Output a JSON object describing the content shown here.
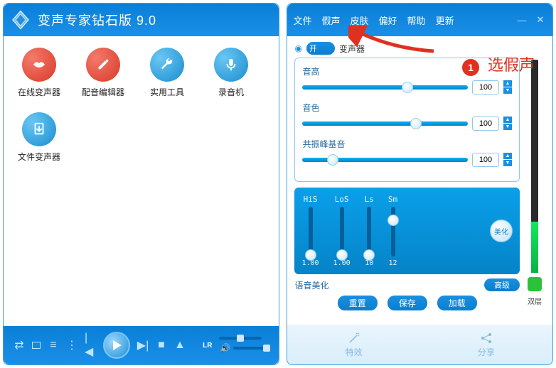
{
  "title": "变声专家钻石版 9.0",
  "tools": [
    {
      "name": "online-voice-changer",
      "label": "在线变声器",
      "color": "red",
      "icon": "lips"
    },
    {
      "name": "dub-editor",
      "label": "配音编辑器",
      "color": "red",
      "icon": "brush"
    },
    {
      "name": "utilities",
      "label": "实用工具",
      "color": "blue",
      "icon": "wrench"
    },
    {
      "name": "recorder",
      "label": "录音机",
      "color": "blue",
      "icon": "mic"
    },
    {
      "name": "file-voice-changer",
      "label": "文件变声器",
      "color": "blue",
      "icon": "doc"
    }
  ],
  "player": {
    "lr": "LR"
  },
  "menu": [
    "文件",
    "假声",
    "皮肤",
    "偏好",
    "帮助",
    "更新"
  ],
  "toggle": {
    "label": "开",
    "title": "变声器"
  },
  "sliders": [
    {
      "name": "pitch",
      "label": "音高",
      "value": "100",
      "pos": 60
    },
    {
      "name": "timbre",
      "label": "音色",
      "value": "100",
      "pos": 65
    },
    {
      "name": "formant",
      "label": "共振峰基音",
      "value": "100",
      "pos": 15
    }
  ],
  "eq": [
    {
      "name": "HiS",
      "val": "1.00",
      "pos": 85
    },
    {
      "name": "LoS",
      "val": "1.00",
      "pos": 85
    },
    {
      "name": "Ls",
      "val": "10",
      "pos": 85
    },
    {
      "name": "Sm",
      "val": "12",
      "pos": 15
    }
  ],
  "beautify": "美化",
  "voice_beauty": "语音美化",
  "advanced": "高级",
  "actions": {
    "reset": "重置",
    "save": "保存",
    "load": "加载"
  },
  "bottom": {
    "effects": "特效",
    "share": "分享"
  },
  "dual": "双层",
  "annotation": {
    "step": "1",
    "text": "选假声"
  }
}
